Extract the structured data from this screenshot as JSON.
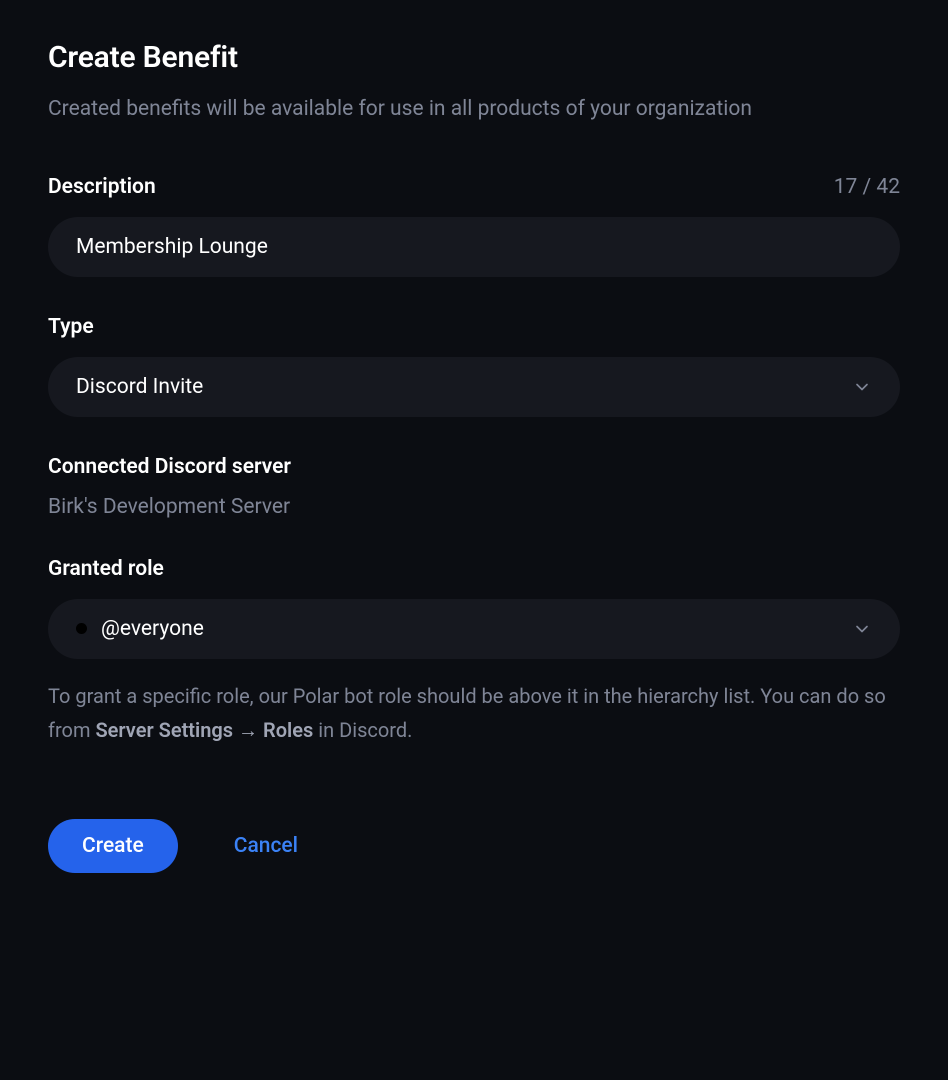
{
  "header": {
    "title": "Create Benefit",
    "subtitle": "Created benefits will be available for use in all products of your organization"
  },
  "description": {
    "label": "Description",
    "value": "Membership Lounge",
    "count": "17 / 42"
  },
  "type": {
    "label": "Type",
    "selected": "Discord Invite"
  },
  "connected": {
    "label": "Connected Discord server",
    "value": "Birk's Development Server"
  },
  "role": {
    "label": "Granted role",
    "selected": "@everyone",
    "help_prefix": "To grant a specific role, our Polar bot role should be above it in the hierarchy list. You can do so from ",
    "help_bold": "Server Settings → Roles",
    "help_suffix": " in Discord."
  },
  "buttons": {
    "create": "Create",
    "cancel": "Cancel"
  }
}
